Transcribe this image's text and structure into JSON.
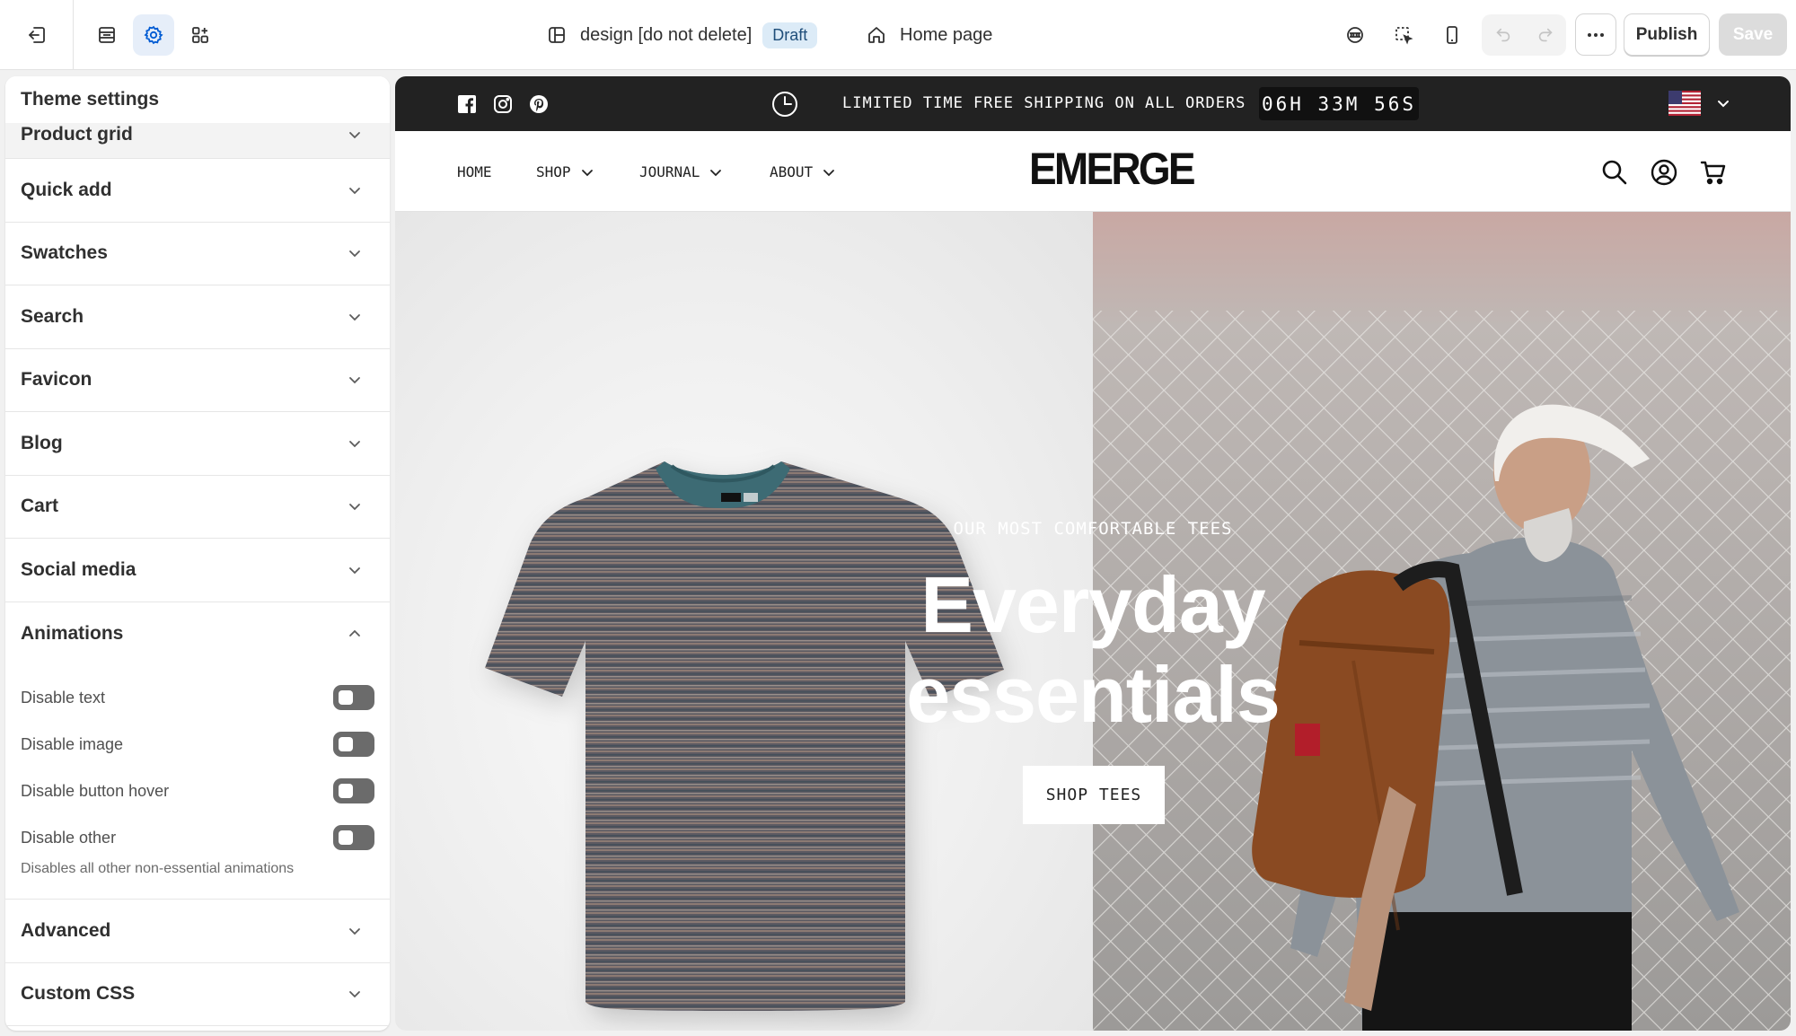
{
  "topbar": {
    "theme_name": "design [do not delete]",
    "status_badge": "Draft",
    "page_selector": "Home page",
    "publish_label": "Publish",
    "save_label": "Save",
    "icons": [
      "exit-icon",
      "sections-icon",
      "theme-settings-icon",
      "apps-icon",
      "theme-icon",
      "home-icon",
      "inspector-icon",
      "select-icon",
      "mobile-view-icon",
      "undo-icon",
      "redo-icon",
      "more-icon"
    ],
    "accent": "#005bd3"
  },
  "sidebar": {
    "title": "Theme settings",
    "sections": [
      {
        "label": "Product grid"
      },
      {
        "label": "Quick add"
      },
      {
        "label": "Swatches"
      },
      {
        "label": "Search"
      },
      {
        "label": "Favicon"
      },
      {
        "label": "Blog"
      },
      {
        "label": "Cart"
      },
      {
        "label": "Social media"
      }
    ],
    "animations": {
      "label": "Animations",
      "toggles": [
        {
          "label": "Disable text",
          "on": false
        },
        {
          "label": "Disable image",
          "on": false
        },
        {
          "label": "Disable button hover",
          "on": false
        },
        {
          "label": "Disable other",
          "on": false
        }
      ],
      "help": "Disables all other non-essential animations"
    },
    "sections_after": [
      {
        "label": "Advanced"
      },
      {
        "label": "Custom CSS"
      }
    ]
  },
  "store": {
    "announcement": "LIMITED TIME FREE SHIPPING ON ALL ORDERS",
    "countdown": "06H 33M 56S",
    "social_icons": [
      "facebook-icon",
      "instagram-icon",
      "pinterest-icon"
    ],
    "nav": [
      {
        "label": "HOME",
        "dropdown": false
      },
      {
        "label": "SHOP",
        "dropdown": true
      },
      {
        "label": "JOURNAL",
        "dropdown": true
      },
      {
        "label": "ABOUT",
        "dropdown": true
      }
    ],
    "logo": "EMERGE",
    "hero": {
      "subtitle": "OUR MOST COMFORTABLE TEES",
      "title_line1": "Everyday",
      "title_line2": "essentials",
      "button": "SHOP TEES"
    }
  }
}
